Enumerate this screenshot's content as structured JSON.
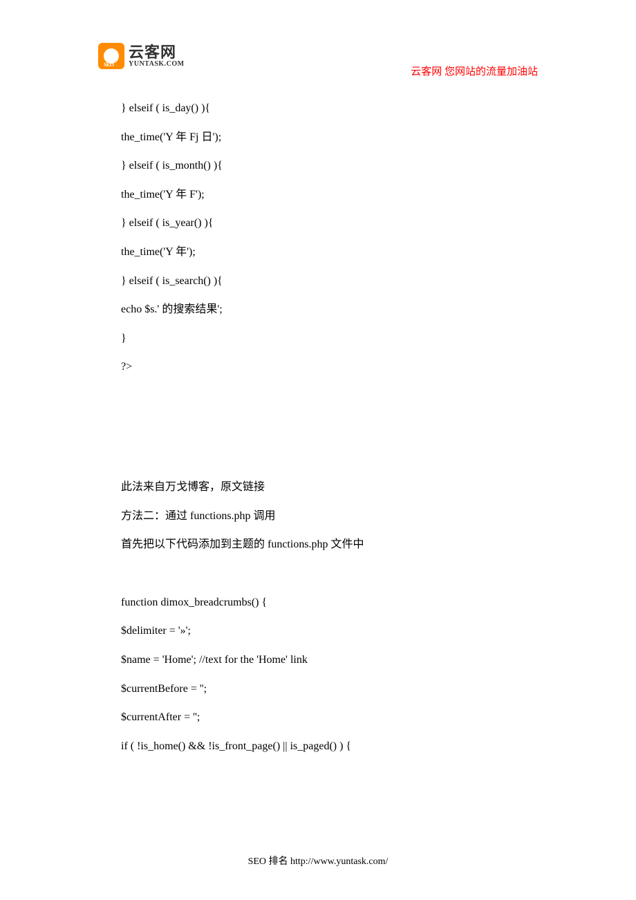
{
  "header": {
    "logo_cn": "云客网",
    "logo_en": "YUNTASK.COM",
    "logo_seo": "SEO",
    "tagline": "云客网  您网站的流量加油站"
  },
  "content": {
    "lines": [
      "} elseif ( is_day() ){",
      "the_time('Y 年 Fj 日');",
      "} elseif ( is_month() ){",
      "the_time('Y 年 F');",
      "} elseif ( is_year() ){",
      "the_time('Y 年');",
      "} elseif ( is_search() ){",
      "echo $s.'  的搜索结果';",
      "}",
      "?>"
    ],
    "note1": "此法来自万戈博客，原文链接",
    "note2": "方法二：通过  functions.php  调用",
    "note3": "首先把以下代码添加到主题的  functions.php  文件中",
    "code2": [
      "function dimox_breadcrumbs() {",
      "$delimiter = '»';",
      "$name = 'Home'; //text for the 'Home' link",
      "$currentBefore = '';",
      "$currentAfter = '';",
      "if ( !is_home() && !is_front_page() || is_paged() ) {"
    ]
  },
  "footer": {
    "text": "SEO 排名 http://www.yuntask.com/"
  }
}
